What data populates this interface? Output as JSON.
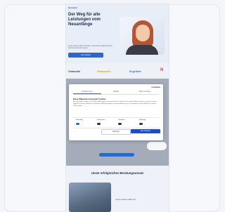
{
  "page": {
    "logo": "Neuraum",
    "hero_title": "Der Weg für alle Leistungen vom Neuanfänge",
    "hero_sub": "Lorem ipsum dolor sit amet, consectetur adipiscing elit. Sed do eiusmod tempor.",
    "hero_cta": "Jetzt starten",
    "brands": [
      "Chancello",
      "Vodacaster",
      "Engelbart",
      "N"
    ],
    "section_title": "Unser erfolgreiches Beratungsansatz",
    "lower_text": "Lorem ipsum dolor sit"
  },
  "cookie": {
    "brand": "Cookiebot",
    "tabs": [
      "Zustimmung",
      "Details",
      "Über Cookies"
    ],
    "title": "Diese Webseite verwendet Cookies",
    "text": "Wir verwenden Cookies, um Inhalte und Anzeigen zu personalisieren, Funktionen für soziale Medien anbieten zu können und die Zugriffe auf unsere Website zu analysieren. Außerdem geben wir Informationen zu Ihrer Verwendung unserer Website an unsere Partner weiter.",
    "toggles": [
      "Notwendig",
      "Präferenzen",
      "Statistiken",
      "Marketing"
    ],
    "deny_label": "Ablehnen",
    "allow_label": "Alle zulassen"
  }
}
